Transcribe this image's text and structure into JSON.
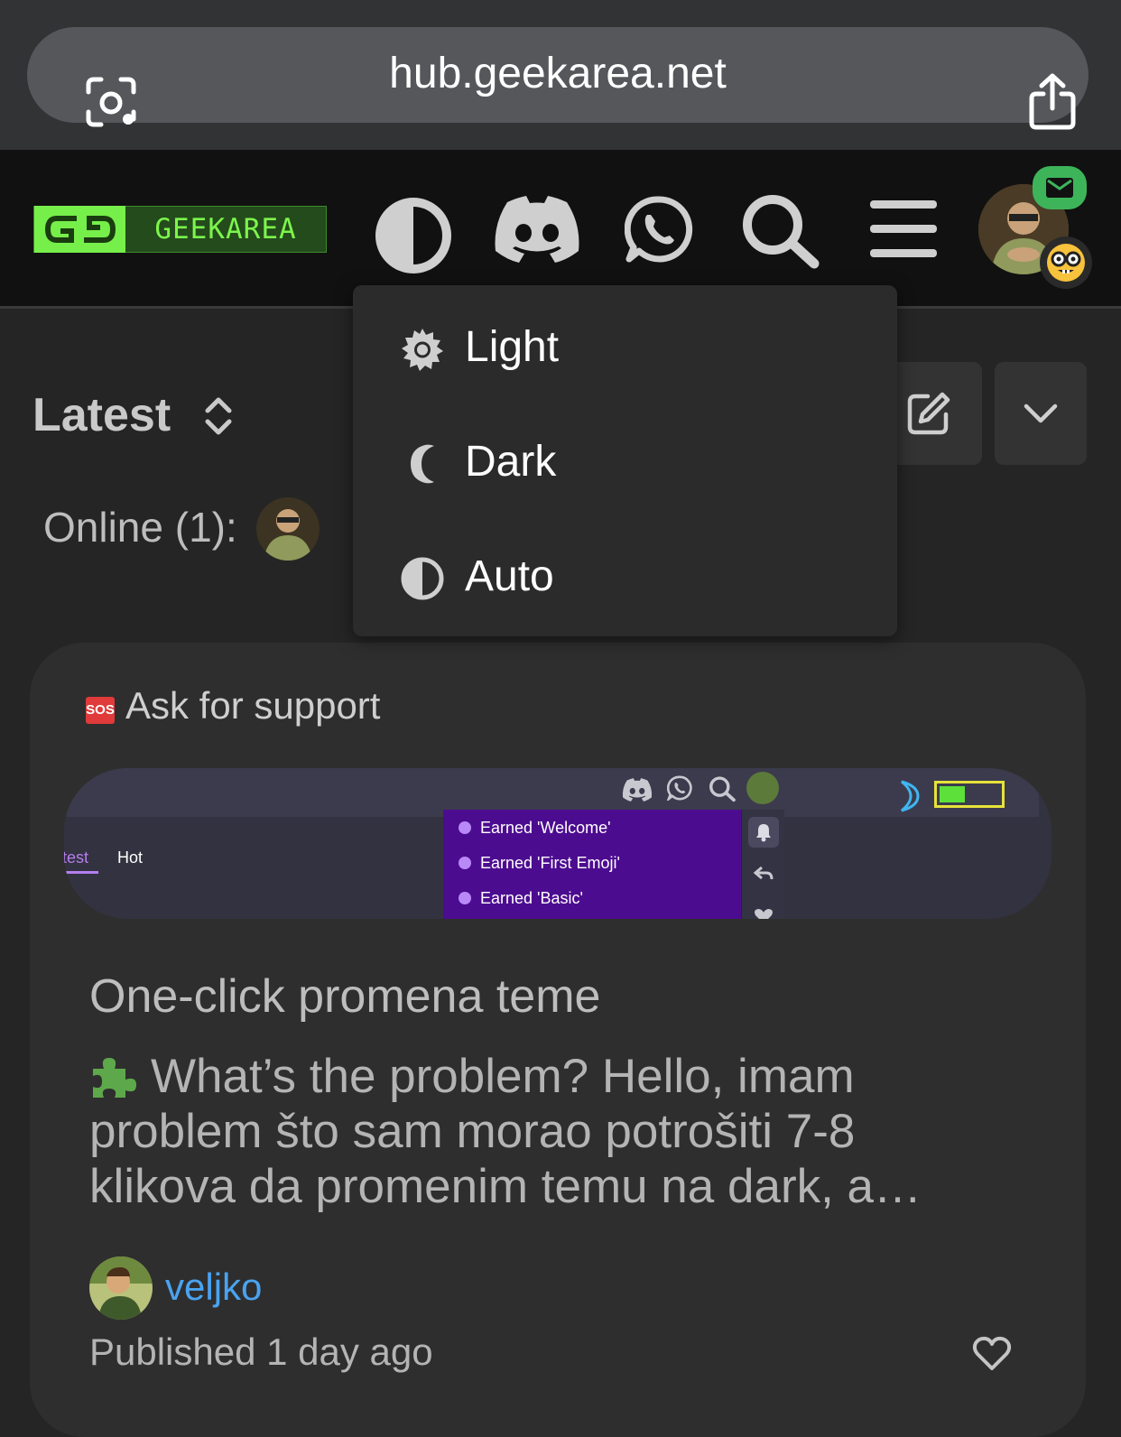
{
  "browser": {
    "url": "hub.geekarea.net"
  },
  "header": {
    "logo_text": "GEEKAREA",
    "icons": [
      "theme-toggle-icon",
      "discord-icon",
      "whatsapp-icon",
      "search-icon",
      "hamburger-menu-icon",
      "user-avatar",
      "mail-badge-icon",
      "nerd-emoji-icon"
    ]
  },
  "theme_menu": {
    "items": [
      {
        "label": "Light",
        "icon": "sun-icon"
      },
      {
        "label": "Dark",
        "icon": "moon-icon"
      },
      {
        "label": "Auto",
        "icon": "half-circle-icon"
      }
    ]
  },
  "feed": {
    "sort_label": "Latest",
    "online_label": "Online (1):"
  },
  "post": {
    "category_badge": "SOS",
    "category": "Ask for support",
    "preview": {
      "tab_latest": "test",
      "tab_hot": "Hot",
      "notifications": [
        "Earned 'Welcome'",
        "Earned 'First Emoji'",
        "Earned 'Basic'"
      ],
      "accent": "#4c0c90"
    },
    "title": "One-click promena teme",
    "excerpt": "What’s the problem? Hello, imam problem što sam morao potrošiti 7-8 klikova da promenim temu na dark, a…",
    "author": "veljko",
    "published": "Published 1 day ago"
  },
  "colors": {
    "background": "#252525",
    "card": "#2e2e2e",
    "brand_green": "#76ef4a",
    "link_blue": "#4aa3f0"
  }
}
